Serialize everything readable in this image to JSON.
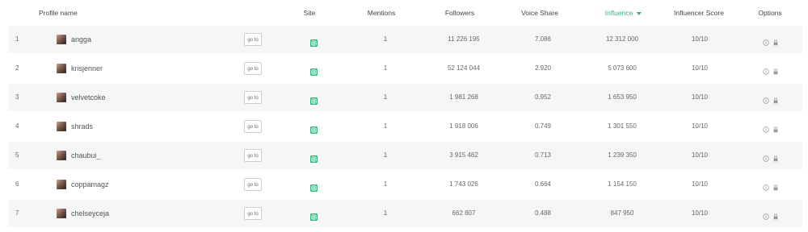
{
  "columns": {
    "profile_name": "Profile name",
    "site": "Site",
    "mentions": "Mentions",
    "followers": "Followers",
    "voice_share": "Voice Share",
    "influence": "Influence",
    "influencer_score": "Influencer Score",
    "options": "Options"
  },
  "active_sort": "influence",
  "colors": {
    "accent": "#2fb37a",
    "row_stripe": "#f6f6f6"
  },
  "goto_label": "go to",
  "rows": [
    {
      "rank": "1",
      "name": "angga",
      "mentions": "1",
      "followers": "11 226 195",
      "voice_share": "7.086",
      "influence": "12 312 000",
      "score": "10/10"
    },
    {
      "rank": "2",
      "name": "krisjenner",
      "mentions": "1",
      "followers": "52 124 044",
      "voice_share": "2.920",
      "influence": "5 073 600",
      "score": "10/10"
    },
    {
      "rank": "3",
      "name": "velvetcoke",
      "mentions": "1",
      "followers": "1 981 268",
      "voice_share": "0.952",
      "influence": "1 653 950",
      "score": "10/10"
    },
    {
      "rank": "4",
      "name": "shrads",
      "mentions": "1",
      "followers": "1 918 006",
      "voice_share": "0.749",
      "influence": "1 301 550",
      "score": "10/10"
    },
    {
      "rank": "5",
      "name": "chaubui_",
      "mentions": "1",
      "followers": "3 915 462",
      "voice_share": "0.713",
      "influence": "1 239 350",
      "score": "10/10"
    },
    {
      "rank": "6",
      "name": "coppamagz",
      "mentions": "1",
      "followers": "1 743 026",
      "voice_share": "0.664",
      "influence": "1 154 150",
      "score": "10/10"
    },
    {
      "rank": "7",
      "name": "chelseyceja",
      "mentions": "1",
      "followers": "662 807",
      "voice_share": "0.488",
      "influence": "847 950",
      "score": "10/10"
    }
  ]
}
